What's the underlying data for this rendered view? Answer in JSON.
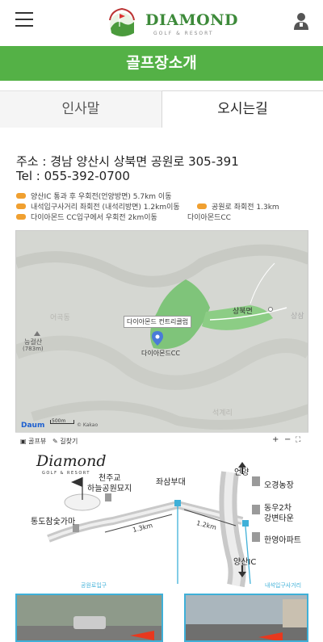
{
  "header": {
    "logo_text": "DIAMOND",
    "logo_sub": "GOLF & RESORT",
    "menu_icon": "hamburger-icon",
    "user_icon": "user-icon"
  },
  "title_bar": {
    "title": "골프장소개"
  },
  "tabs": [
    {
      "label": "인사말",
      "active": false
    },
    {
      "label": "오시는길",
      "active": true
    }
  ],
  "contact": {
    "address": "주소 : 경남 양산시 상북면 공원로 305-391",
    "tel": "Tel : 055-392-0700"
  },
  "routes": [
    "양산IC 통과 후 우회전(언양방면) 5.7km 이동",
    "내석입구사거리 좌회전 (내석리방면) 1.2km이동",
    "공원로 좌회전 1.3km",
    "다이아몬드 CC입구에서 우회전 2km이동",
    "다이아몬드CC"
  ],
  "map": {
    "labels": {
      "course": "다이아몬드 컨트리클럽",
      "marker": "다이아몬드CC",
      "town": "상북면",
      "mountain": "능걸산",
      "mountain_height": "(783m)",
      "far_right": "상삼",
      "left_top": "어곡동",
      "bottom": "석계리",
      "scale": "500m",
      "brand": "Daum",
      "copyright": "© Kakao"
    },
    "toolbar": {
      "terrain": "골프뷰",
      "roadview": "길찾기",
      "zoom_in": "+",
      "zoom_out": "−",
      "fullscreen": "⛶"
    }
  },
  "diagram": {
    "logo": "Diamond",
    "logo_sub": "GOLF & RESORT",
    "labels": {
      "cheonjugyo": "천주교",
      "haneul": "하늘공원묘지",
      "jwasam": "좌삼부대",
      "dongdo": "통도참숯가마",
      "eonyang": "언양",
      "ogyeong": "오경농장",
      "dongwoo": "동우2차",
      "gangbyeon": "강변타운",
      "hanyang": "한영아파트",
      "yangsan_ic": "양산IC",
      "dist1": "1.3km",
      "dist2": "1.2km",
      "park_entrance": "공원로입구",
      "naeseok": "내석입구사거리"
    }
  },
  "colors": {
    "brand_green": "#54b146",
    "logo_green": "#3d8a3a",
    "route_dot": "#f0a030",
    "diagram_blue": "#3fb0d8"
  }
}
